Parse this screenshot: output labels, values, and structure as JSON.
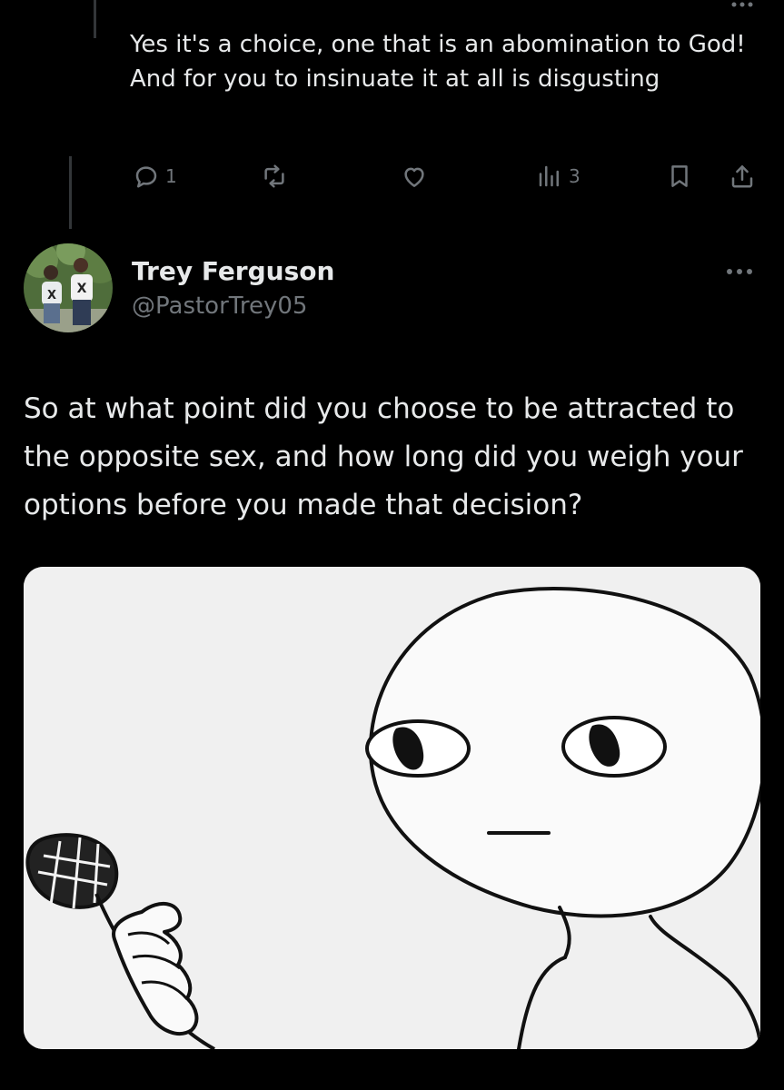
{
  "previous_reply": {
    "text": "Yes it's a choice, one that is an abomination to God! And for you to insinuate it at all is disgusting",
    "actions": {
      "reply_count": "1",
      "repost_count": "",
      "like_count": "",
      "views_count": "3"
    }
  },
  "post": {
    "author_name": "Trey Ferguson",
    "author_handle": "@PastorTrey05",
    "text": "So at what point did you choose to be attracted to the opposite sex, and how long did you weigh your options before you made that decision?"
  },
  "icons": {
    "reply": "comment-bubble-icon",
    "repost": "repost-icon",
    "like": "heart-icon",
    "views": "analytics-bars-icon",
    "bookmark": "bookmark-icon",
    "share": "share-icon",
    "more": "more-dots-icon"
  },
  "colors": {
    "background": "#000000",
    "primary_text": "#e7e9ea",
    "secondary_text": "#71767b",
    "thread_line": "#333639"
  }
}
